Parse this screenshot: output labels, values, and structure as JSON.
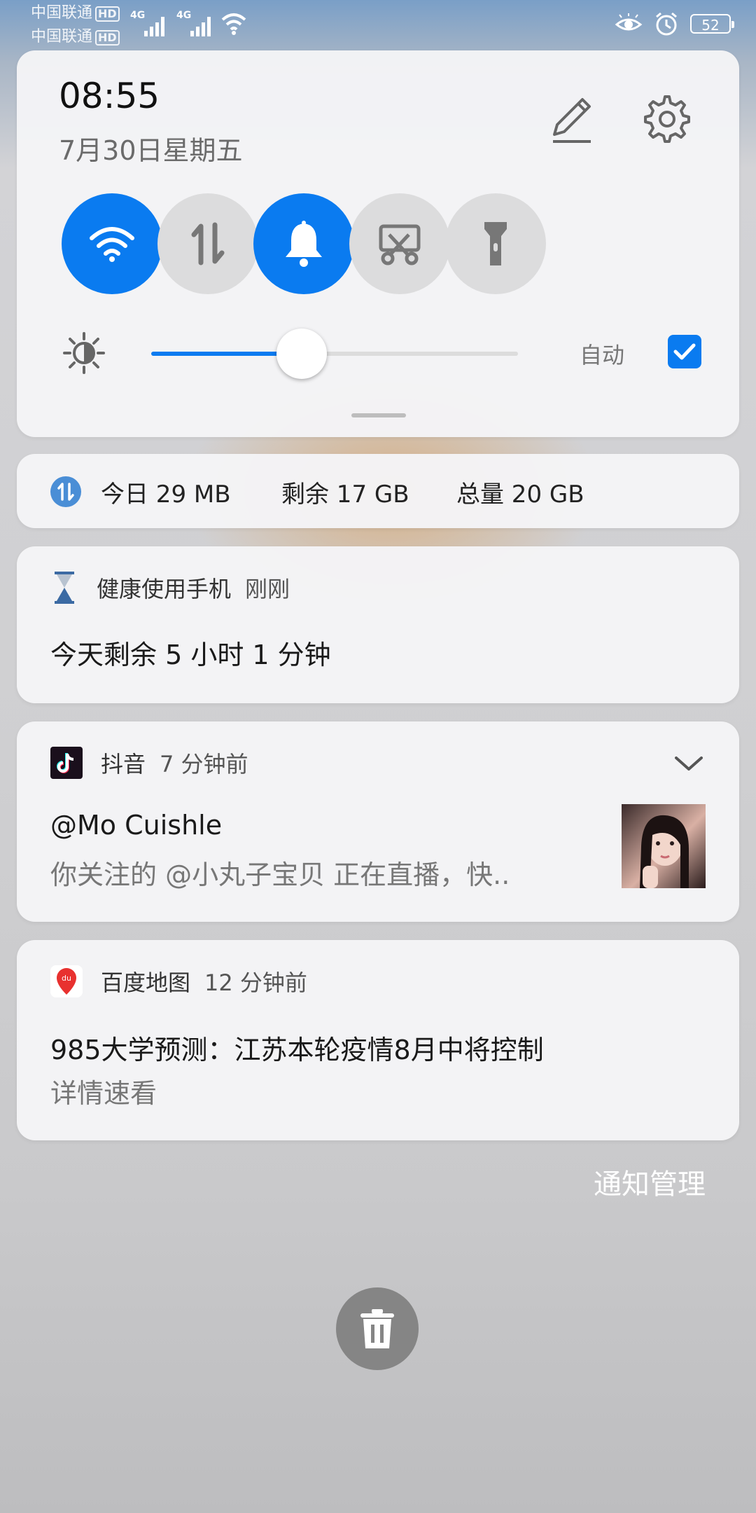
{
  "status_bar": {
    "carrier1": "中国联通",
    "carrier2": "中国联通",
    "hd_badge": "HD",
    "network1": "4G",
    "network2": "4G",
    "battery": "52",
    "icons": [
      "eye-comfort-icon",
      "alarm-icon"
    ]
  },
  "quick_settings": {
    "time": "08:55",
    "date": "7月30日星期五",
    "tiles": [
      {
        "name": "wifi",
        "icon": "wifi-icon",
        "on": true
      },
      {
        "name": "mobile-data",
        "icon": "data-arrows-icon",
        "on": false
      },
      {
        "name": "sound",
        "icon": "bell-icon",
        "on": true
      },
      {
        "name": "screenshot",
        "icon": "screenshot-icon",
        "on": false
      },
      {
        "name": "flashlight",
        "icon": "flashlight-icon",
        "on": false
      }
    ],
    "brightness_level": 0.41,
    "auto_label": "自动",
    "auto_checked": true
  },
  "data_usage": {
    "today": "今日 29 MB",
    "remaining": "剩余 17 GB",
    "total": "总量 20 GB"
  },
  "notifications": [
    {
      "app": "健康使用手机",
      "time": "刚刚",
      "title": "今天剩余 5 小时 1 分钟"
    },
    {
      "app": "抖音",
      "time": "7 分钟前",
      "title": "@Mo Cuishle",
      "body": "你关注的 @小丸子宝贝 正在直播，快.."
    },
    {
      "app": "百度地图",
      "time": "12 分钟前",
      "title": "985大学预测：江苏本轮疫情8月中将控制",
      "body": "详情速看"
    }
  ],
  "manage_label": "通知管理",
  "colors": {
    "accent": "#0a7bf0"
  }
}
